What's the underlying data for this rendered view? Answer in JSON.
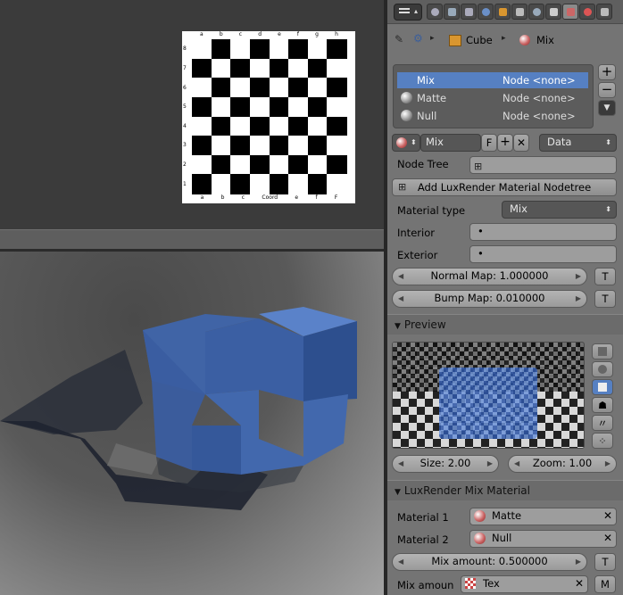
{
  "breadcrumb": {
    "object": "Cube",
    "material": "Mix"
  },
  "material_slots": [
    {
      "name": "Mix",
      "node": "Node <none>"
    },
    {
      "name": "Matte",
      "node": "Node <none>"
    },
    {
      "name": "Null",
      "node": "Node <none>"
    }
  ],
  "material_selector": {
    "name": "Mix",
    "fake_user": "F",
    "link": "Data"
  },
  "node_tree_label": "Node Tree",
  "add_nodetree_label": "Add LuxRender Material Nodetree",
  "material_type": {
    "label": "Material type",
    "value": "Mix"
  },
  "interior": {
    "label": "Interior",
    "value": "•"
  },
  "exterior": {
    "label": "Exterior",
    "value": "•"
  },
  "normal_map": "Normal Map: 1.000000",
  "bump_map": "Bump Map: 0.010000",
  "t_label": "T",
  "preview": {
    "title": "Preview",
    "size": "Size: 2.00",
    "zoom": "Zoom: 1.00"
  },
  "mix_section": {
    "title": "LuxRender Mix Material",
    "material1_label": "Material 1",
    "material1": "Matte",
    "material2_label": "Material 2",
    "material2": "Null",
    "mix_amount": "Mix amount: 0.500000",
    "mix_amoun_label": "Mix amoun",
    "texture": "Tex",
    "m_label": "M"
  },
  "checker_labels": {
    "top": [
      "a",
      "b",
      "c",
      "d",
      "e",
      "f",
      "g",
      "h"
    ],
    "bottom": [
      "a",
      "b",
      "c",
      "Coord",
      "e",
      "f",
      "F"
    ],
    "left": [
      "8",
      "7",
      "6",
      "5",
      "4",
      "3",
      "2",
      "1"
    ]
  },
  "colors": {
    "accent": "#5680c2",
    "panel": "#747474",
    "cube_blue": "#3f65ad"
  }
}
